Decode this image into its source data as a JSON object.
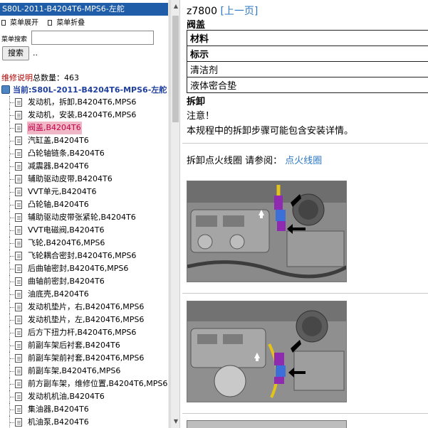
{
  "left": {
    "title": "S80L-2011-B4204T6-MPS6-左舵",
    "menu_expand": "菜单展开",
    "menu_collapse": "菜单折叠",
    "search_label": "菜单搜索",
    "search_value": "",
    "search_button": "搜索",
    "dots": "..",
    "count_label": "维修说明",
    "count_text": "总数量：463",
    "current": "当前:S80L-2011-B4204T6-MPS6-左舵",
    "items": [
      {
        "label": "发动机，拆卸,B4204T6,MPS6"
      },
      {
        "label": "发动机，安装,B4204T6,MPS6"
      },
      {
        "label": "阀盖,B4204T6"
      },
      {
        "label": "汽缸盖,B4204T6"
      },
      {
        "label": "凸轮轴链条,B4204T6"
      },
      {
        "label": "减震器,B4204T6"
      },
      {
        "label": "辅助驱动皮带,B4204T6"
      },
      {
        "label": "VVT单元,B4204T6"
      },
      {
        "label": "凸轮轴,B4204T6"
      },
      {
        "label": "辅助驱动皮带张紧轮,B4204T6"
      },
      {
        "label": "VVT电磁阀,B4204T6"
      },
      {
        "label": "飞轮,B4204T6,MPS6"
      },
      {
        "label": "飞轮耦合密封,B4204T6,MPS6"
      },
      {
        "label": "后曲轴密封,B4204T6,MPS6"
      },
      {
        "label": "曲轴前密封,B4204T6"
      },
      {
        "label": "油底壳,B4204T6"
      },
      {
        "label": "发动机垫片，右,B4204T6,MPS6"
      },
      {
        "label": "发动机垫片，左,B4204T6,MPS6"
      },
      {
        "label": "后方下扭力杆,B4204T6,MPS6"
      },
      {
        "label": "前副车架后衬套,B4204T6"
      },
      {
        "label": "前副车架前衬套,B4204T6,MPS6"
      },
      {
        "label": "前副车架,B4204T6,MPS6"
      },
      {
        "label": "前方副车架，维修位置,B4204T6,MPS6"
      },
      {
        "label": "发动机机油,B4204T6"
      },
      {
        "label": "集油器,B4204T6"
      },
      {
        "label": "机油泵,B4204T6"
      }
    ],
    "active_index": 2
  },
  "right": {
    "doc_id": "z7800",
    "prev_link": "[上一页]",
    "section_title": "阀盖",
    "table": [
      {
        "text": "材料",
        "bold": true
      },
      {
        "text": "标示",
        "bold": true
      },
      {
        "text": "清洁剂",
        "bold": false
      },
      {
        "text": "液体密合垫",
        "bold": false
      }
    ],
    "removal_title": "拆卸",
    "notice": "注意！",
    "notice_body": "本规程中的拆卸步骤可能包含安装详情。",
    "ref_text": "拆卸点火线圈 请参阅：",
    "ref_link": "点火线圈"
  },
  "colors": {
    "title_bar": "#1f5da8",
    "active_highlight": "#f0b8c6",
    "link": "#2d78c6",
    "count_label": "#b00000",
    "marker_purple": "#8e2bb0",
    "marker_blue": "#3d6fd8",
    "marker_yellow": "#e3c21a"
  }
}
